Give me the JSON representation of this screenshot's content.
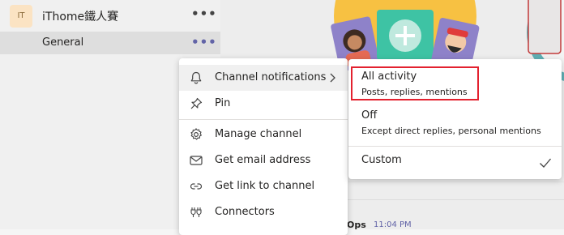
{
  "team": {
    "avatar_initials": "IT",
    "name": "iThome鐵人賽",
    "more_label": "•••"
  },
  "channel": {
    "name": "General",
    "more_label": "•••"
  },
  "channel_menu": {
    "items": [
      {
        "label": "Channel notifications",
        "icon": "bell-icon",
        "has_submenu": true
      },
      {
        "label": "Pin",
        "icon": "pin-icon"
      },
      {
        "label": "Manage channel",
        "icon": "gear-icon"
      },
      {
        "label": "Get email address",
        "icon": "mail-icon"
      },
      {
        "label": "Get link to channel",
        "icon": "link-icon"
      },
      {
        "label": "Connectors",
        "icon": "connectors-icon"
      }
    ]
  },
  "notifications_submenu": {
    "all_activity": {
      "title": "All activity",
      "subtitle": "Posts, replies, mentions"
    },
    "off": {
      "title": "Off",
      "subtitle": "Except direct replies, personal mentions"
    },
    "custom": {
      "title": "Custom",
      "selected": true
    }
  },
  "post": {
    "author_fragment": "Ops",
    "time": "11:04 PM"
  },
  "colors": {
    "accent": "#6264a7",
    "highlight": "#e3212f",
    "banner_yellow": "#f7c142",
    "banner_teal": "#3ec3a4"
  }
}
